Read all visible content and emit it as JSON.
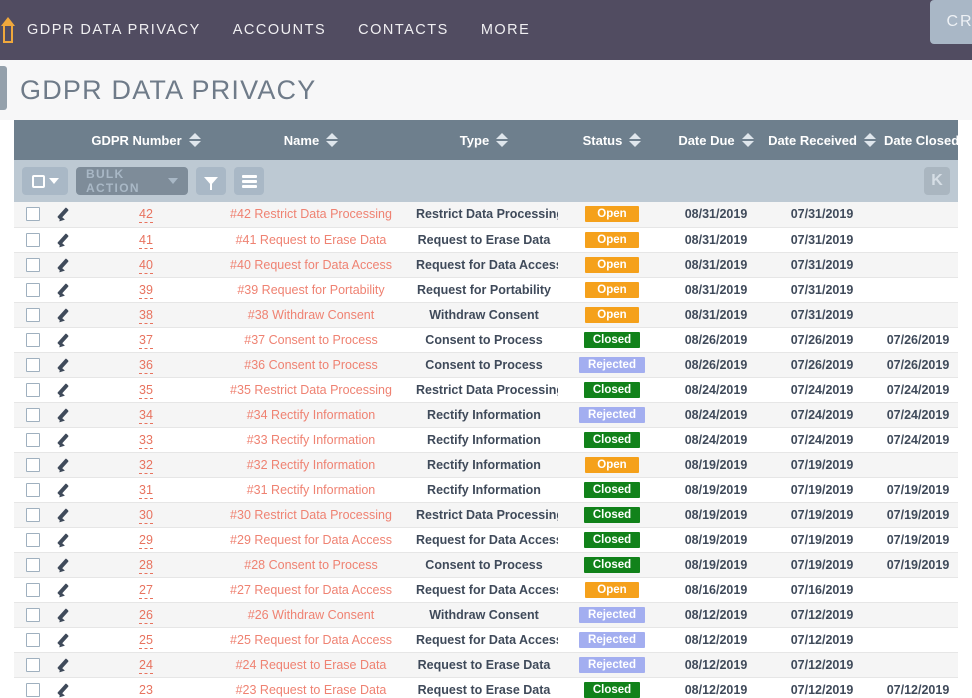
{
  "navbar": {
    "brand_icon": "home-icon",
    "items": [
      {
        "label": "GDPR Data Privacy"
      },
      {
        "label": "Accounts"
      },
      {
        "label": "Contacts"
      },
      {
        "label": "More"
      }
    ],
    "chip_label": "CR"
  },
  "page": {
    "title": "GDPR DATA PRIVACY"
  },
  "toolbar": {
    "select_all_icon": "checkbox-dropdown-icon",
    "bulk_action_label": "Bulk Action",
    "filter_icon": "filter-icon",
    "column_chooser_icon": "list-view-icon",
    "pager_first_label": "K"
  },
  "table": {
    "columns": [
      {
        "key": "checkbox",
        "label": "",
        "sortable": false
      },
      {
        "key": "edit",
        "label": "",
        "sortable": false
      },
      {
        "key": "gdpr_number",
        "label": "GDPR Number",
        "sortable": true
      },
      {
        "key": "name",
        "label": "Name",
        "sortable": true
      },
      {
        "key": "type",
        "label": "Type",
        "sortable": true
      },
      {
        "key": "status",
        "label": "Status",
        "sortable": true
      },
      {
        "key": "date_due",
        "label": "Date Due",
        "sortable": true
      },
      {
        "key": "date_received",
        "label": "Date Received",
        "sortable": true
      },
      {
        "key": "date_closed",
        "label": "Date Closed",
        "sortable": false
      }
    ],
    "status_colors": {
      "Open": "#f5a11b",
      "Closed": "#11821a",
      "Rejected": "#a3aef0"
    },
    "rows": [
      {
        "gdpr_number": "42",
        "name": "#42 Restrict Data Processing",
        "type": "Restrict Data Processing",
        "status": "Open",
        "date_due": "08/31/2019",
        "date_received": "07/31/2019",
        "date_closed": ""
      },
      {
        "gdpr_number": "41",
        "name": "#41 Request to Erase Data",
        "type": "Request to Erase Data",
        "status": "Open",
        "date_due": "08/31/2019",
        "date_received": "07/31/2019",
        "date_closed": ""
      },
      {
        "gdpr_number": "40",
        "name": "#40 Request for Data Access",
        "type": "Request for Data Access",
        "status": "Open",
        "date_due": "08/31/2019",
        "date_received": "07/31/2019",
        "date_closed": ""
      },
      {
        "gdpr_number": "39",
        "name": "#39 Request for Portability",
        "type": "Request for Portability",
        "status": "Open",
        "date_due": "08/31/2019",
        "date_received": "07/31/2019",
        "date_closed": ""
      },
      {
        "gdpr_number": "38",
        "name": "#38 Withdraw Consent",
        "type": "Withdraw Consent",
        "status": "Open",
        "date_due": "08/31/2019",
        "date_received": "07/31/2019",
        "date_closed": ""
      },
      {
        "gdpr_number": "37",
        "name": "#37 Consent to Process",
        "type": "Consent to Process",
        "status": "Closed",
        "date_due": "08/26/2019",
        "date_received": "07/26/2019",
        "date_closed": "07/26/2019"
      },
      {
        "gdpr_number": "36",
        "name": "#36 Consent to Process",
        "type": "Consent to Process",
        "status": "Rejected",
        "date_due": "08/26/2019",
        "date_received": "07/26/2019",
        "date_closed": "07/26/2019"
      },
      {
        "gdpr_number": "35",
        "name": "#35 Restrict Data Processing",
        "type": "Restrict Data Processing",
        "status": "Closed",
        "date_due": "08/24/2019",
        "date_received": "07/24/2019",
        "date_closed": "07/24/2019"
      },
      {
        "gdpr_number": "34",
        "name": "#34 Rectify Information",
        "type": "Rectify Information",
        "status": "Rejected",
        "date_due": "08/24/2019",
        "date_received": "07/24/2019",
        "date_closed": "07/24/2019"
      },
      {
        "gdpr_number": "33",
        "name": "#33 Rectify Information",
        "type": "Rectify Information",
        "status": "Closed",
        "date_due": "08/24/2019",
        "date_received": "07/24/2019",
        "date_closed": "07/24/2019"
      },
      {
        "gdpr_number": "32",
        "name": "#32 Rectify Information",
        "type": "Rectify Information",
        "status": "Open",
        "date_due": "08/19/2019",
        "date_received": "07/19/2019",
        "date_closed": ""
      },
      {
        "gdpr_number": "31",
        "name": "#31 Rectify Information",
        "type": "Rectify Information",
        "status": "Closed",
        "date_due": "08/19/2019",
        "date_received": "07/19/2019",
        "date_closed": "07/19/2019"
      },
      {
        "gdpr_number": "30",
        "name": "#30 Restrict Data Processing",
        "type": "Restrict Data Processing",
        "status": "Closed",
        "date_due": "08/19/2019",
        "date_received": "07/19/2019",
        "date_closed": "07/19/2019"
      },
      {
        "gdpr_number": "29",
        "name": "#29 Request for Data Access",
        "type": "Request for Data Access",
        "status": "Closed",
        "date_due": "08/19/2019",
        "date_received": "07/19/2019",
        "date_closed": "07/19/2019"
      },
      {
        "gdpr_number": "28",
        "name": "#28 Consent to Process",
        "type": "Consent to Process",
        "status": "Closed",
        "date_due": "08/19/2019",
        "date_received": "07/19/2019",
        "date_closed": "07/19/2019"
      },
      {
        "gdpr_number": "27",
        "name": "#27 Request for Data Access",
        "type": "Request for Data Access",
        "status": "Open",
        "date_due": "08/16/2019",
        "date_received": "07/16/2019",
        "date_closed": ""
      },
      {
        "gdpr_number": "26",
        "name": "#26 Withdraw Consent",
        "type": "Withdraw Consent",
        "status": "Rejected",
        "date_due": "08/12/2019",
        "date_received": "07/12/2019",
        "date_closed": ""
      },
      {
        "gdpr_number": "25",
        "name": "#25 Request for Data Access",
        "type": "Request for Data Access",
        "status": "Rejected",
        "date_due": "08/12/2019",
        "date_received": "07/12/2019",
        "date_closed": ""
      },
      {
        "gdpr_number": "24",
        "name": "#24 Request to Erase Data",
        "type": "Request to Erase Data",
        "status": "Rejected",
        "date_due": "08/12/2019",
        "date_received": "07/12/2019",
        "date_closed": ""
      },
      {
        "gdpr_number": "23",
        "name": "#23 Request to Erase Data",
        "type": "Request to Erase Data",
        "status": "Closed",
        "date_due": "08/12/2019",
        "date_received": "07/12/2019",
        "date_closed": "07/12/2019"
      }
    ]
  }
}
